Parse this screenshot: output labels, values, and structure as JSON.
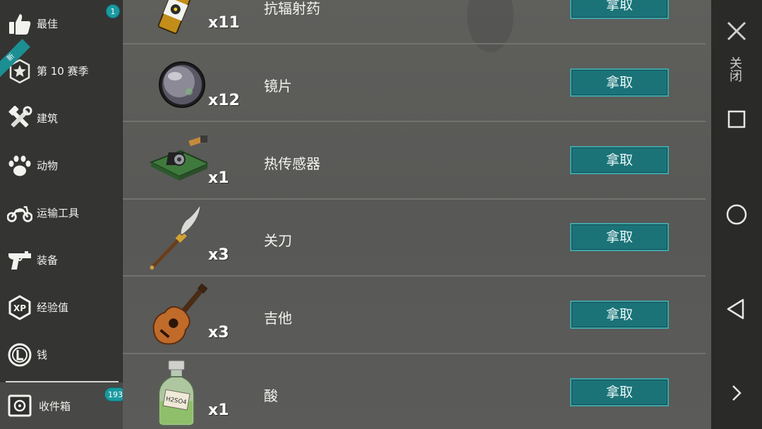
{
  "sidebar": {
    "items": [
      {
        "label": "最佳",
        "icon": "thumbs-up-icon",
        "badge": "1"
      },
      {
        "label": "第 10 赛季",
        "icon": "season-star-icon",
        "ribbon": "新"
      },
      {
        "label": "建筑",
        "icon": "hammer-wrench-icon"
      },
      {
        "label": "动物",
        "icon": "paw-icon"
      },
      {
        "label": "运输工具",
        "icon": "motorcycle-icon"
      },
      {
        "label": "装备",
        "icon": "pistol-icon"
      },
      {
        "label": "经验值",
        "icon": "xp-icon"
      },
      {
        "label": "钱",
        "icon": "coin-icon"
      }
    ],
    "inbox": {
      "label": "收件箱",
      "icon": "safe-icon",
      "badge": "193"
    }
  },
  "list": {
    "take_label": "拿取",
    "rows": [
      {
        "name": "抗辐射药",
        "qty": "x11",
        "icon": "radiation-pills-icon"
      },
      {
        "name": "镜片",
        "qty": "x12",
        "icon": "lens-icon"
      },
      {
        "name": "热传感器",
        "qty": "x1",
        "icon": "thermal-sensor-icon"
      },
      {
        "name": "关刀",
        "qty": "x3",
        "icon": "guandao-blade-icon"
      },
      {
        "name": "吉他",
        "qty": "x3",
        "icon": "guitar-icon"
      },
      {
        "name": "酸",
        "qty": "x1",
        "icon": "acid-bottle-icon",
        "bottle_label": "H2SO4"
      }
    ]
  },
  "navbar": {
    "close_label": "关闭",
    "icons": [
      "close-icon",
      "recent-apps-icon",
      "home-icon",
      "back-icon",
      "chevron-right-icon"
    ]
  },
  "colors": {
    "accent": "#1a9aa0",
    "button": "#1b7378",
    "sidebar_bg": "#343433",
    "main_bg": "#5b5b59"
  }
}
